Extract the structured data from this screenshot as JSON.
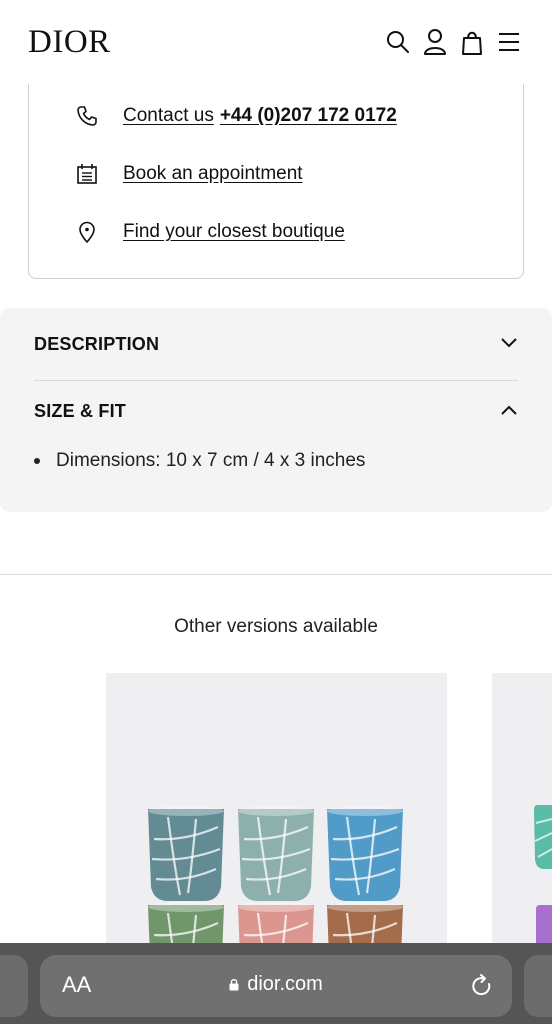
{
  "header": {
    "logo": "DIOR",
    "icons": [
      "search-icon",
      "account-icon",
      "bag-icon",
      "menu-icon"
    ]
  },
  "contact": {
    "contact_label": "Contact us",
    "phone": "+44 (0)207 172 0172",
    "appointment_label": "Book an appointment",
    "boutique_label": "Find your closest boutique"
  },
  "accordion": {
    "description_title": "DESCRIPTION",
    "size_fit_title": "SIZE & FIT",
    "size_fit_items": [
      "Dimensions: 10 x 7 cm / 4 x 3 inches"
    ]
  },
  "other_versions": {
    "title": "Other versions available"
  },
  "browser": {
    "text_size_label": "AA",
    "url": "dior.com"
  },
  "colors": {
    "panel_bg": "#f4f4f4",
    "card_bg": "#efeff1",
    "browser_bar": "#555555",
    "glass_colors": [
      "#4f7d86",
      "#7fa7a3",
      "#3b8fc2",
      "#5f8a57",
      "#d98a82",
      "#9a5a32"
    ]
  }
}
